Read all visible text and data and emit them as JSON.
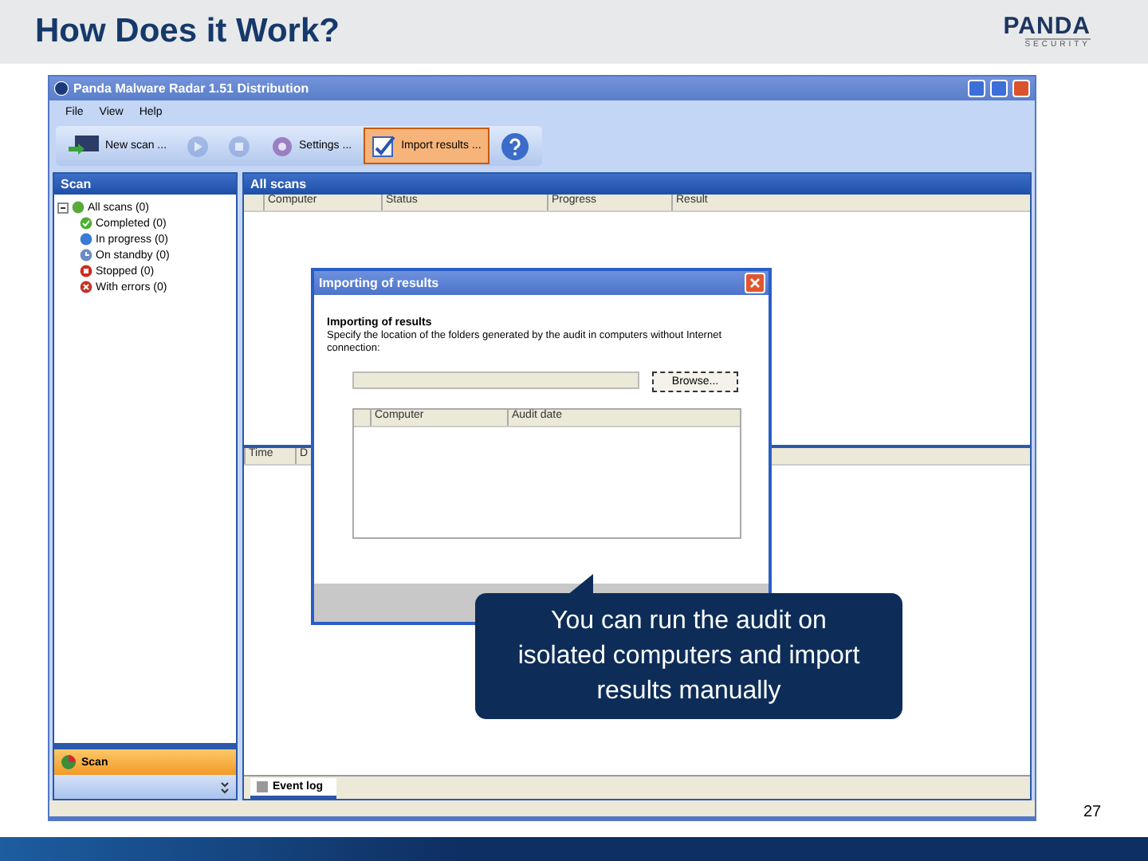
{
  "slide": {
    "title": "How Does it Work?",
    "logo": {
      "name": "PANDA",
      "tagline": "SECURITY"
    },
    "page_number": "27"
  },
  "window": {
    "title": "Panda Malware Radar 1.51 Distribution"
  },
  "menu": [
    "File",
    "View",
    "Help"
  ],
  "toolbar": [
    {
      "kind": "new",
      "label": "New scan ...",
      "selected": false,
      "disabled": false
    },
    {
      "kind": "play",
      "selected": false,
      "disabled": true
    },
    {
      "kind": "stop",
      "selected": false,
      "disabled": true
    },
    {
      "kind": "settings",
      "label": "Settings ...",
      "selected": false,
      "disabled": false
    },
    {
      "kind": "import",
      "label": "Import results ...",
      "selected": true,
      "disabled": false
    },
    {
      "kind": "help",
      "selected": false,
      "disabled": false
    }
  ],
  "sidebar": {
    "header": "Scan",
    "tree": [
      {
        "label": "All scans (0)",
        "kind": "all",
        "expanded": true,
        "children": [
          {
            "label": "Completed (0)",
            "kind": "check"
          },
          {
            "label": "In progress (0)",
            "kind": "progress"
          },
          {
            "label": "On standby (0)",
            "kind": "clock"
          },
          {
            "label": "Stopped (0)",
            "kind": "stop"
          },
          {
            "label": "With errors (0)",
            "kind": "error"
          }
        ]
      }
    ],
    "button": "Scan"
  },
  "main": {
    "header": "All scans",
    "columns": [
      "Computer",
      "Status",
      "Progress",
      "Result"
    ]
  },
  "log": {
    "columns": [
      "Time",
      "D"
    ],
    "tab": "Event log"
  },
  "dialog": {
    "title": "Importing of results",
    "heading": "Importing of results",
    "description": "Specify the location of the folders generated by the audit in computers without Internet connection:",
    "browse": "Browse...",
    "columns": [
      "Computer",
      "Audit date"
    ]
  },
  "callout": "You can run the audit on isolated computers and import results manually"
}
